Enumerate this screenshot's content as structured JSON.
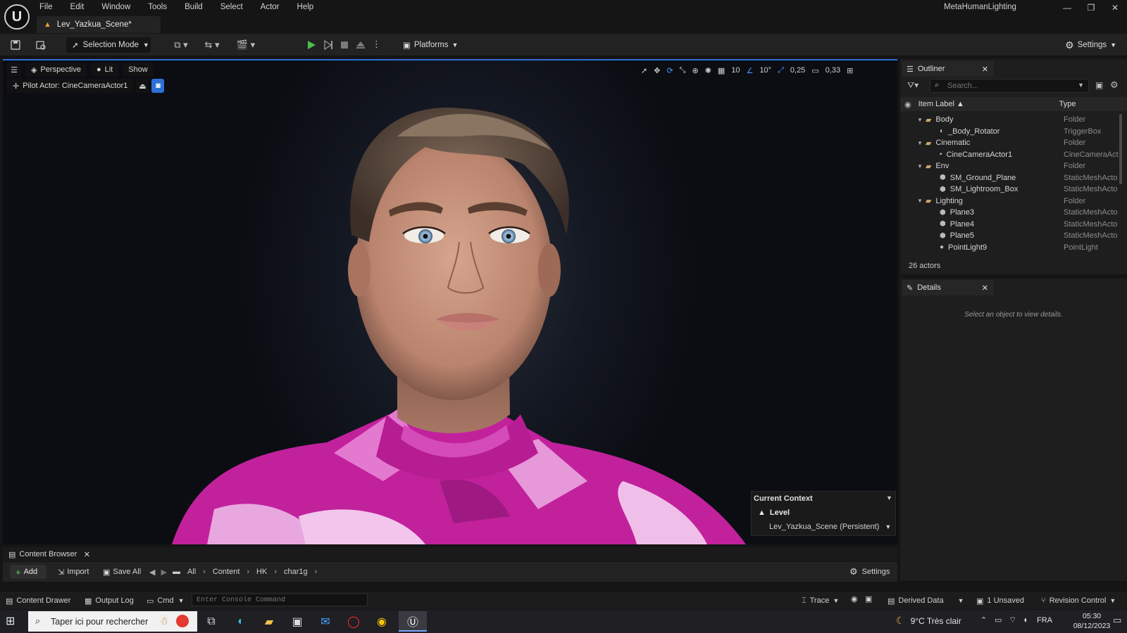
{
  "app": {
    "project_name": "MetaHumanLighting",
    "logo_letter": "U",
    "menu": [
      "File",
      "Edit",
      "Window",
      "Tools",
      "Build",
      "Select",
      "Actor",
      "Help"
    ],
    "window_controls": [
      "—",
      "❐",
      "✕"
    ]
  },
  "document_tab": {
    "label": "Lev_Yazkua_Scene*"
  },
  "toolbar": {
    "selection_mode": "Selection Mode",
    "platforms": "Platforms",
    "settings": "Settings"
  },
  "viewport": {
    "perspective": "Perspective",
    "lit": "Lit",
    "show": "Show",
    "pilot_actor": "Pilot Actor: CineCameraActor1",
    "grid_size": "10",
    "rotation_snap": "10°",
    "scale_snap": "0,25",
    "camera_speed": "0,33",
    "accent_color": "#2d6fd6",
    "shirt_color": "#c4229e"
  },
  "current_context": {
    "title": "Current Context",
    "level_label": "Level",
    "level_value": "Lev_Yazkua_Scene (Persistent)"
  },
  "outliner": {
    "tab_label": "Outliner",
    "search_placeholder": "Search...",
    "col_label": "Item Label ▲",
    "col_type": "Type",
    "rows": [
      {
        "label": "Body",
        "type": "Folder",
        "folder": true,
        "indent": 0
      },
      {
        "label": "_Body_Rotator",
        "type": "TriggerBox",
        "folder": false,
        "indent": 1,
        "icon": "trigger"
      },
      {
        "label": "Cinematic",
        "type": "Folder",
        "folder": true,
        "indent": 0
      },
      {
        "label": "CineCameraActor1",
        "type": "CineCameraAct",
        "folder": false,
        "indent": 1,
        "icon": "camera"
      },
      {
        "label": "Env",
        "type": "Folder",
        "folder": true,
        "indent": 0
      },
      {
        "label": "SM_Ground_Plane",
        "type": "StaticMeshActo",
        "folder": false,
        "indent": 1,
        "icon": "mesh"
      },
      {
        "label": "SM_Lightroom_Box",
        "type": "StaticMeshActo",
        "folder": false,
        "indent": 1,
        "icon": "mesh"
      },
      {
        "label": "Lighting",
        "type": "Folder",
        "folder": true,
        "indent": 0
      },
      {
        "label": "Plane3",
        "type": "StaticMeshActo",
        "folder": false,
        "indent": 1,
        "icon": "mesh"
      },
      {
        "label": "Plane4",
        "type": "StaticMeshActo",
        "folder": false,
        "indent": 1,
        "icon": "mesh"
      },
      {
        "label": "Plane5",
        "type": "StaticMeshActo",
        "folder": false,
        "indent": 1,
        "icon": "mesh"
      },
      {
        "label": "PointLight9",
        "type": "PointLight",
        "folder": false,
        "indent": 1,
        "icon": "light"
      }
    ],
    "actor_count": "26 actors"
  },
  "details": {
    "tab_label": "Details",
    "empty_text": "Select an object to view details."
  },
  "content_browser": {
    "tab_label": "Content Browser",
    "add": "Add",
    "import": "Import",
    "save_all": "Save All",
    "breadcrumbs": [
      "All",
      "Content",
      "HK",
      "char1g"
    ],
    "settings": "Settings"
  },
  "statusbar": {
    "content_drawer": "Content Drawer",
    "output_log": "Output Log",
    "cmd": "Cmd",
    "console_placeholder": "Enter Console Command",
    "trace": "Trace",
    "derived_data": "Derived Data",
    "unsaved": "1 Unsaved",
    "revision_control": "Revision Control"
  },
  "taskbar": {
    "search_placeholder": "Taper ici pour rechercher",
    "weather": "9°C  Très clair",
    "language": "FRA",
    "time": "05:30",
    "date": "08/12/2023"
  }
}
